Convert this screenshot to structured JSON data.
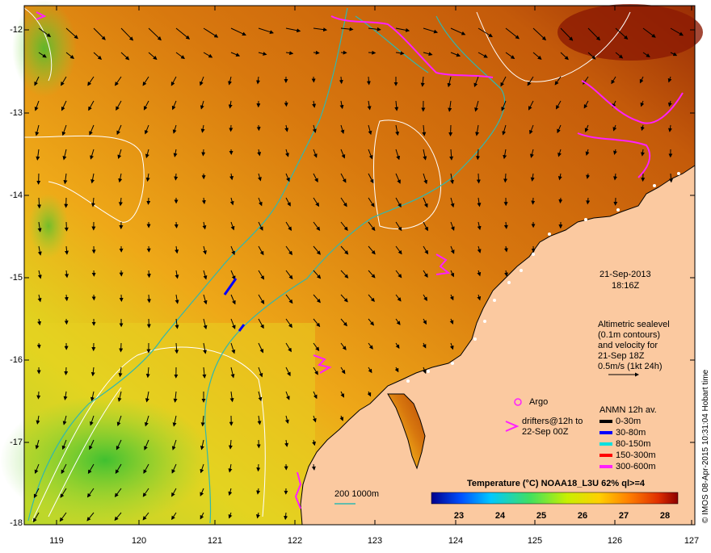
{
  "map": {
    "x_ticks": [
      "119",
      "120",
      "121",
      "122",
      "123",
      "124",
      "125",
      "126",
      "127"
    ],
    "y_ticks": [
      "-12",
      "-13",
      "-14",
      "-15",
      "-16",
      "-17",
      "-18"
    ],
    "colors": {
      "land": "#fbc9a0",
      "sea_warm": "#c8640a",
      "sea_mid": "#e88c14",
      "sea_cool": "#f0c020",
      "sea_green": "#64d232",
      "contour_sealevel": "#ffffff",
      "isobath": "#2fb8b0",
      "drifter": "#ff20ff"
    }
  },
  "annotations": {
    "datetime_line1": "21-Sep-2013",
    "datetime_line2": "18:16Z",
    "sealevel_line1": "Altimetric sealevel",
    "sealevel_line2": "(0.1m contours)",
    "sealevel_line3": "and velocity for",
    "sealevel_line4": "21-Sep 18Z",
    "sealevel_line5": "0.5m/s (1kt 24h)",
    "argo_label": "Argo",
    "drifters_line1": "drifters@12h to",
    "drifters_line2": "22-Sep 00Z",
    "isobath_label": "200  1000m",
    "credit": "© IMOS 08-Apr-2015 10:31:04 Hobart time"
  },
  "anmn_legend": {
    "title": "ANMN 12h av.",
    "items": [
      {
        "label": "0-30m",
        "color": "#000000"
      },
      {
        "label": "30-80m",
        "color": "#0000ff"
      },
      {
        "label": "80-150m",
        "color": "#00e0e0"
      },
      {
        "label": "150-300m",
        "color": "#ff0000"
      },
      {
        "label": "300-600m",
        "color": "#ff20ff"
      }
    ]
  },
  "colorbar": {
    "title": "Temperature (°C) NOAA18_L3U 62% ql>=4",
    "ticks": [
      "23",
      "24",
      "25",
      "26",
      "27",
      "28"
    ],
    "stops": [
      "#00008c",
      "#0050ff",
      "#00c8ff",
      "#40e060",
      "#c8f000",
      "#ffd000",
      "#ff8000",
      "#e03000",
      "#8c0000"
    ]
  }
}
